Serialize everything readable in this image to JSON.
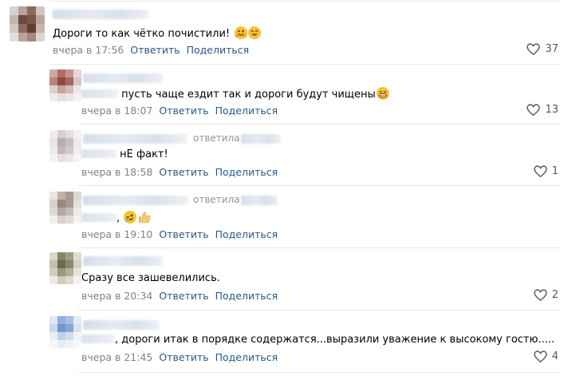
{
  "actions": {
    "reply": "Ответить",
    "share": "Поделиться"
  },
  "comments": [
    {
      "text": "Дороги то как чётко почистили!",
      "date": "вчера в 17:56",
      "likes": "37",
      "replied": ""
    },
    {
      "text": "пусть чаще ездит так и дороги будут чищены",
      "date": "вчера в 18:07",
      "likes": "13",
      "replied": ""
    },
    {
      "text": "нЕ факт!",
      "date": "вчера в 18:58",
      "likes": "1",
      "replied": "ответила"
    },
    {
      "text": ",",
      "date": "вчера в 19:10",
      "likes": "",
      "replied": "ответила"
    },
    {
      "text": "Сразу все зашевелились.",
      "date": "вчера в 20:34",
      "likes": "2",
      "replied": ""
    },
    {
      "text": ", дороги итак в порядке содержатся...выразили уважение к высокому гостю.....",
      "date": "вчера в 21:45",
      "likes": "4",
      "replied": ""
    }
  ],
  "icons": {
    "like": "heart-outline-icon"
  },
  "colors": {
    "link": "#2a5885",
    "meta": "#828282",
    "like": "#4f5a66",
    "divider": "#e7e8ec"
  }
}
